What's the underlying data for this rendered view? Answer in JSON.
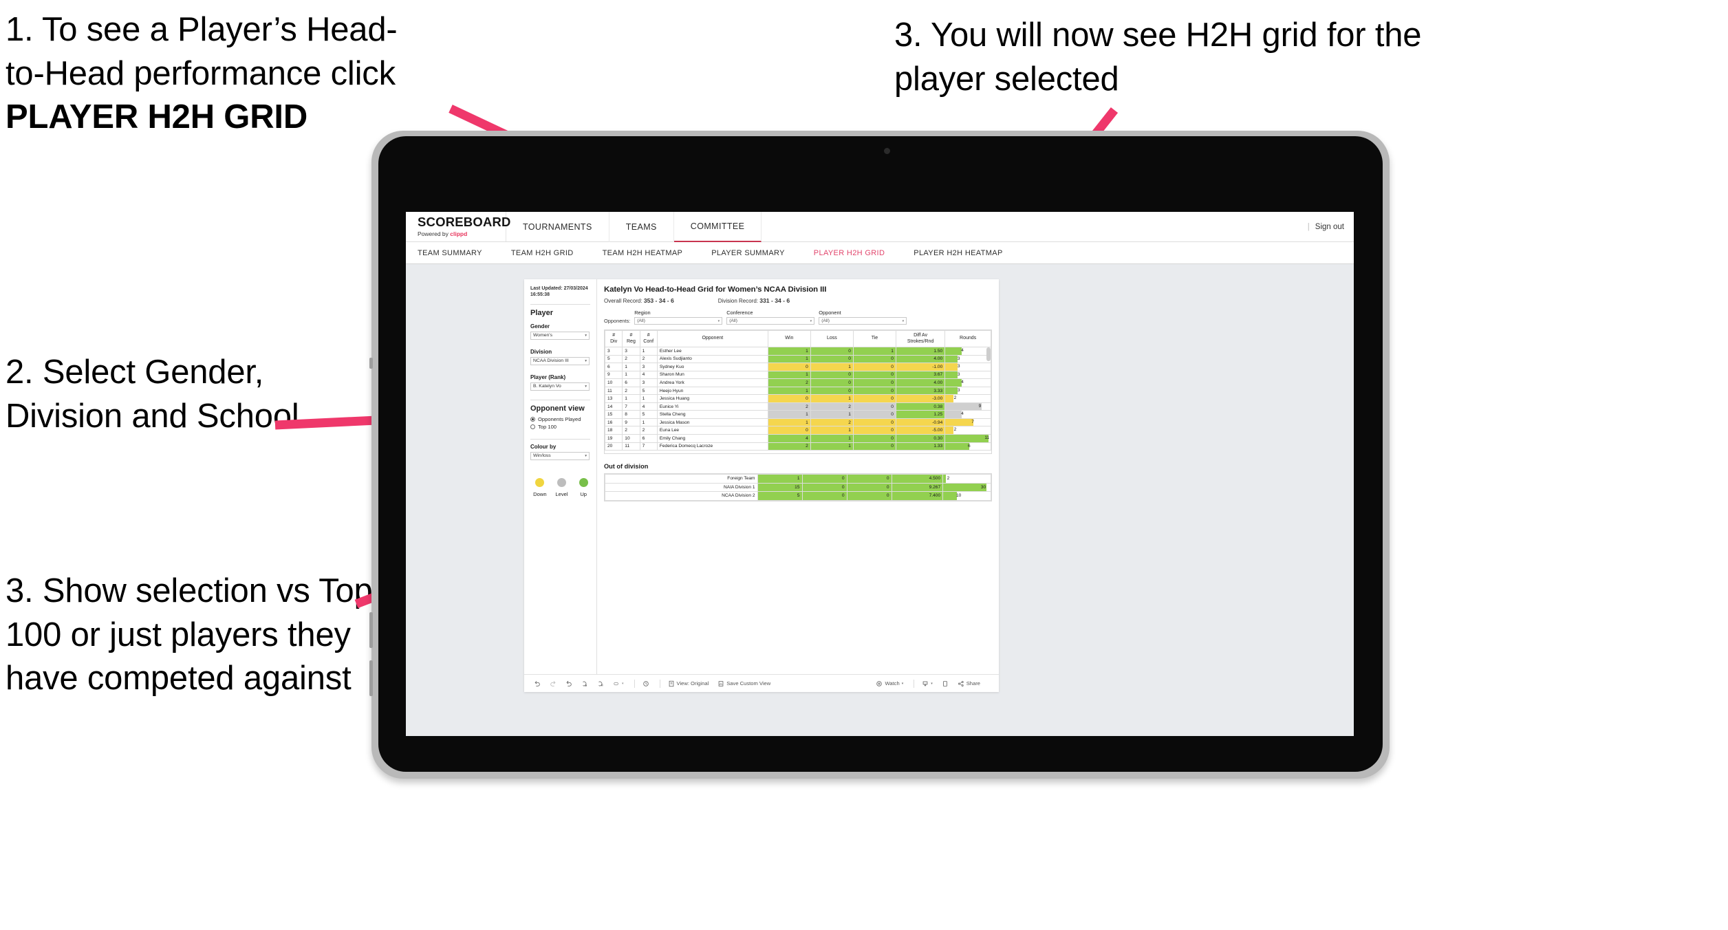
{
  "annotations": {
    "callout1_line1": "1. To see a Player’s Head-",
    "callout1_line2": "to-Head performance click",
    "callout1_bold": "PLAYER H2H GRID",
    "callout2": "2. Select Gender, Division and School",
    "callout3": "3. Show selection vs Top 100 or just players they have competed against",
    "callout4": "3. You will now see H2H grid for the player selected",
    "arrow_color": "#ef386b"
  },
  "app": {
    "brand_title": "SCOREBOARD",
    "brand_sub_prefix": "Powered by ",
    "brand_sub_accent": "clippd",
    "accent_color": "#e2456c",
    "top_nav": [
      {
        "label": "TOURNAMENTS",
        "active": false
      },
      {
        "label": "TEAMS",
        "active": false
      },
      {
        "label": "COMMITTEE",
        "active": true
      }
    ],
    "sign_out": "Sign out",
    "sign_out_divider": "|",
    "sub_nav": [
      {
        "label": "TEAM SUMMARY",
        "active": false
      },
      {
        "label": "TEAM H2H GRID",
        "active": false
      },
      {
        "label": "TEAM H2H HEATMAP",
        "active": false
      },
      {
        "label": "PLAYER SUMMARY",
        "active": false
      },
      {
        "label": "PLAYER H2H GRID",
        "active": true
      },
      {
        "label": "PLAYER H2H HEATMAP",
        "active": false
      }
    ]
  },
  "pane": {
    "last_updated": "Last Updated: 27/03/2024 16:55:38",
    "section_title": "Player",
    "filters": [
      {
        "label": "Gender",
        "value": "Women's"
      },
      {
        "label": "Division",
        "value": "NCAA Division III"
      },
      {
        "label": "Player (Rank)",
        "value": "B. Katelyn Vo"
      }
    ],
    "opponent_view_title": "Opponent view",
    "opponent_view_options": [
      {
        "label": "Opponents Played",
        "selected": true
      },
      {
        "label": "Top 100",
        "selected": false
      }
    ],
    "colour_by_label": "Colour by",
    "colour_by_value": "Win/loss",
    "legend": [
      {
        "label": "Down",
        "color": "#f0d53f"
      },
      {
        "label": "Level",
        "color": "#bdbdbd"
      },
      {
        "label": "Up",
        "color": "#78bf4a"
      }
    ]
  },
  "main": {
    "title": "Katelyn Vo Head-to-Head Grid for Women’s NCAA Division III",
    "overall_record_label": "Overall Record:",
    "overall_record_value": "353 - 34 - 6",
    "division_record_label": "Division Record:",
    "division_record_value": "331 - 34 - 6",
    "opponents_label": "Opponents:",
    "opponent_filters": [
      {
        "label": "Region",
        "value": "(All)"
      },
      {
        "label": "Conference",
        "value": "(All)"
      },
      {
        "label": "Opponent",
        "value": "(All)"
      }
    ],
    "columns": [
      {
        "l1": "#",
        "l2": "Div"
      },
      {
        "l1": "#",
        "l2": "Reg"
      },
      {
        "l1": "#",
        "l2": "Conf"
      },
      {
        "l1": "Opponent",
        "l2": ""
      },
      {
        "l1": "Win",
        "l2": ""
      },
      {
        "l1": "Loss",
        "l2": ""
      },
      {
        "l1": "Tie",
        "l2": ""
      },
      {
        "l1": "Diff Av",
        "l2": "Strokes/Rnd"
      },
      {
        "l1": "Rounds",
        "l2": ""
      }
    ],
    "rows": [
      {
        "div": "3",
        "reg": "3",
        "conf": "1",
        "opponent": "Esther Lee",
        "win": "1",
        "loss": "0",
        "tie": "1",
        "diff": "1.50",
        "rounds": "4",
        "color": "g",
        "bar_pct": 36
      },
      {
        "div": "5",
        "reg": "2",
        "conf": "2",
        "opponent": "Alexis Sudjianto",
        "win": "1",
        "loss": "0",
        "tie": "0",
        "diff": "4.00",
        "rounds": "3",
        "color": "g",
        "bar_pct": 27
      },
      {
        "div": "6",
        "reg": "1",
        "conf": "3",
        "opponent": "Sydney Kuo",
        "win": "0",
        "loss": "1",
        "tie": "0",
        "diff": "-1.00",
        "rounds": "3",
        "color": "y",
        "bar_pct": 27
      },
      {
        "div": "9",
        "reg": "1",
        "conf": "4",
        "opponent": "Sharon Mun",
        "win": "1",
        "loss": "0",
        "tie": "0",
        "diff": "3.67",
        "rounds": "3",
        "color": "g",
        "bar_pct": 27
      },
      {
        "div": "10",
        "reg": "6",
        "conf": "3",
        "opponent": "Andrea York",
        "win": "2",
        "loss": "0",
        "tie": "0",
        "diff": "4.00",
        "rounds": "4",
        "color": "g",
        "bar_pct": 36
      },
      {
        "div": "11",
        "reg": "2",
        "conf": "5",
        "opponent": "Heejo Hyun",
        "win": "1",
        "loss": "0",
        "tie": "0",
        "diff": "3.33",
        "rounds": "3",
        "color": "g",
        "bar_pct": 27
      },
      {
        "div": "13",
        "reg": "1",
        "conf": "1",
        "opponent": "Jessica Huang",
        "win": "0",
        "loss": "1",
        "tie": "0",
        "diff": "-3.00",
        "rounds": "2",
        "color": "y",
        "bar_pct": 18
      },
      {
        "div": "14",
        "reg": "7",
        "conf": "4",
        "opponent": "Eunice Yi",
        "win": "2",
        "loss": "2",
        "tie": "0",
        "diff": "0.38",
        "rounds": "9",
        "color": "gr",
        "bar_pct": 80,
        "diff_color": "g"
      },
      {
        "div": "15",
        "reg": "8",
        "conf": "5",
        "opponent": "Stella Cheng",
        "win": "1",
        "loss": "1",
        "tie": "0",
        "diff": "1.25",
        "rounds": "4",
        "color": "gr",
        "bar_pct": 36,
        "diff_color": "g"
      },
      {
        "div": "16",
        "reg": "9",
        "conf": "1",
        "opponent": "Jessica Mason",
        "win": "1",
        "loss": "2",
        "tie": "0",
        "diff": "-0.94",
        "rounds": "7",
        "color": "y",
        "bar_pct": 62
      },
      {
        "div": "18",
        "reg": "2",
        "conf": "2",
        "opponent": "Euna Lee",
        "win": "0",
        "loss": "1",
        "tie": "0",
        "diff": "-5.00",
        "rounds": "2",
        "color": "y",
        "bar_pct": 18
      },
      {
        "div": "19",
        "reg": "10",
        "conf": "6",
        "opponent": "Emily Chang",
        "win": "4",
        "loss": "1",
        "tie": "0",
        "diff": "0.30",
        "rounds": "11",
        "color": "g",
        "bar_pct": 95
      },
      {
        "div": "20",
        "reg": "11",
        "conf": "7",
        "opponent": "Federica Domecq Lacroze",
        "win": "2",
        "loss": "1",
        "tie": "0",
        "diff": "1.33",
        "rounds": "6",
        "color": "g",
        "bar_pct": 53
      }
    ],
    "out_of_division_title": "Out of division",
    "out_of_division_rows": [
      {
        "name": "Foreign Team",
        "win": "1",
        "loss": "0",
        "tie": "0",
        "diff": "4.500",
        "rounds": "2",
        "color": "g",
        "bar_pct": 6
      },
      {
        "name": "NAIA Division 1",
        "win": "15",
        "loss": "0",
        "tie": "0",
        "diff": "9.267",
        "rounds": "30",
        "color": "g",
        "bar_pct": 91
      },
      {
        "name": "NCAA Division 2",
        "win": "5",
        "loss": "0",
        "tie": "0",
        "diff": "7.400",
        "rounds": "10",
        "color": "g",
        "bar_pct": 29
      }
    ]
  },
  "toolbar": {
    "view_label": "View: Original",
    "save_label": "Save Custom View",
    "watch_label": "Watch",
    "share_label": "Share"
  }
}
